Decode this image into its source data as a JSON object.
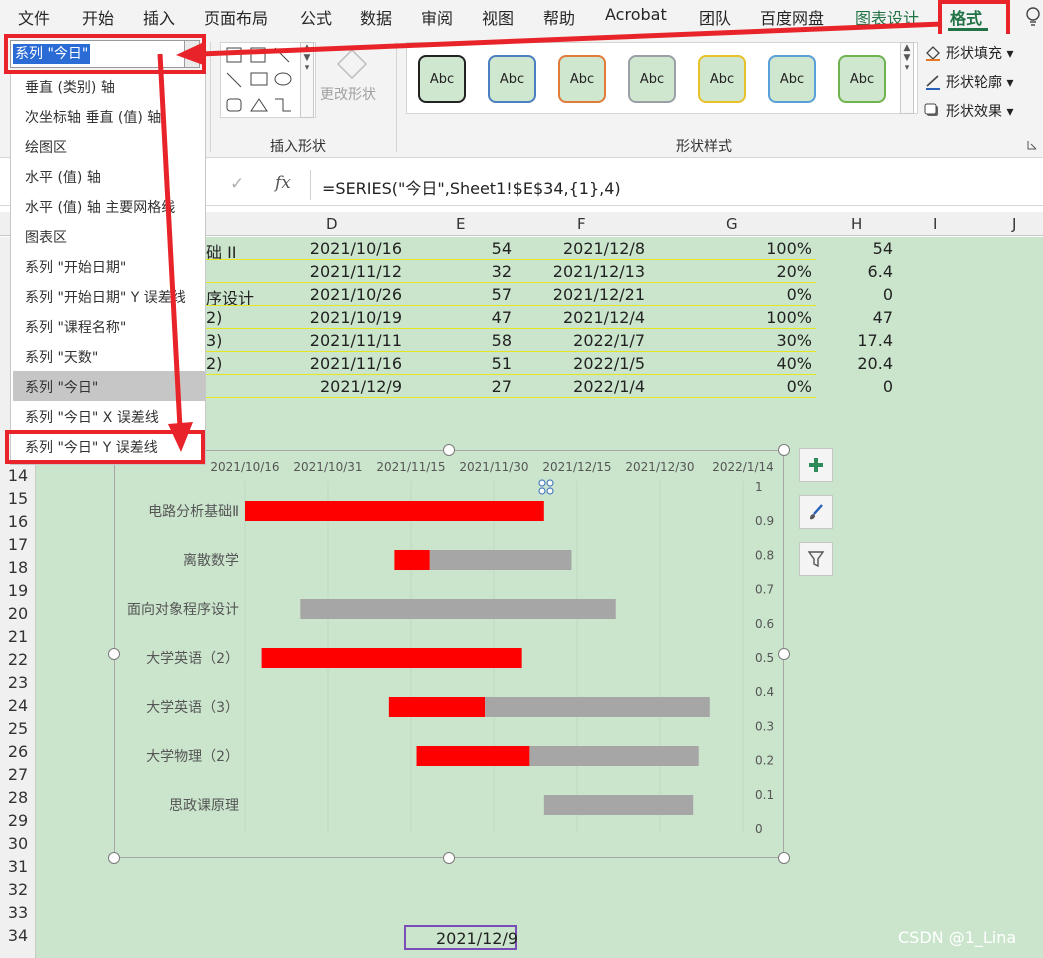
{
  "ribbon": {
    "tabs": [
      "文件",
      "开始",
      "插入",
      "页面布局",
      "公式",
      "数据",
      "审阅",
      "视图",
      "帮助",
      "Acrobat",
      "团队",
      "百度网盘",
      "图表设计",
      "格式"
    ],
    "insert_shapes_label": "插入形状",
    "change_shape_label": "更改形状",
    "shape_styles_label": "形状样式",
    "style_sample": "Abc",
    "shape_fill": "形状填充",
    "shape_outline": "形状轮廓",
    "shape_effects": "形状效果",
    "lightbulb_icon": "lightbulb-icon"
  },
  "namebox": {
    "value": "系列 \"今日\""
  },
  "dropdown": {
    "items": [
      "垂直 (类别) 轴",
      "次坐标轴 垂直 (值) 轴",
      "绘图区",
      "水平 (值) 轴",
      "水平 (值) 轴 主要网格线",
      "图表区",
      "系列 \"开始日期\"",
      "系列 \"开始日期\" Y 误差线",
      "系列 \"课程名称\"",
      "系列 \"天数\"",
      "系列 \"今日\"",
      "系列 \"今日\" X 误差线",
      "系列 \"今日\" Y 误差线"
    ]
  },
  "formula_bar": {
    "cancel": "×",
    "enter": "✓",
    "fx": "fx",
    "formula": "=SERIES(\"今日\",Sheet1!$E$34,{1},4)"
  },
  "columns": [
    "D",
    "E",
    "F",
    "G",
    "H",
    "I",
    "J"
  ],
  "table_rows": [
    {
      "c": "础 II",
      "d": "2021/10/16",
      "e": "54",
      "f": "2021/12/8",
      "g": "100%",
      "h": "54"
    },
    {
      "c": "",
      "d": "2021/11/12",
      "e": "32",
      "f": "2021/12/13",
      "g": "20%",
      "h": "6.4"
    },
    {
      "c": "序设计",
      "d": "2021/10/26",
      "e": "57",
      "f": "2021/12/21",
      "g": "0%",
      "h": "0"
    },
    {
      "c": "2)",
      "d": "2021/10/19",
      "e": "47",
      "f": "2021/12/4",
      "g": "100%",
      "h": "47"
    },
    {
      "c": "3)",
      "d": "2021/11/11",
      "e": "58",
      "f": "2022/1/7",
      "g": "30%",
      "h": "17.4"
    },
    {
      "c": "2)",
      "d": "2021/11/16",
      "e": "51",
      "f": "2022/1/5",
      "g": "40%",
      "h": "20.4"
    },
    {
      "c": "",
      "d": "2021/12/9",
      "e": "27",
      "f": "2022/1/4",
      "g": "0%",
      "h": "0"
    }
  ],
  "row_numbers": [
    "14",
    "15",
    "16",
    "17",
    "18",
    "19",
    "20",
    "21",
    "22",
    "23",
    "24",
    "25",
    "26",
    "27",
    "28",
    "29",
    "30",
    "31",
    "32",
    "33",
    "34"
  ],
  "selected_cell_value": "2021/12/9",
  "watermark": "CSDN @1_Lina",
  "colors": {
    "accent": "#217346",
    "sheet_bg": "#cbe5cd",
    "annotation_red": "#e8242a",
    "done_bar": "#ff0000",
    "remaining_bar": "#a6a6a6"
  },
  "chart_data": {
    "type": "bar",
    "orientation": "horizontal-stacked",
    "categories": [
      "电路分析基础Ⅱ",
      "离散数学",
      "面向对象程序设计",
      "大学英语（2）",
      "大学英语（3）",
      "大学物理（2）",
      "思政课原理"
    ],
    "x_ticks": [
      "2021/10/16",
      "2021/10/31",
      "2021/11/15",
      "2021/11/30",
      "2021/12/15",
      "2021/12/30",
      "2022/1/14"
    ],
    "xlim": [
      "2021/10/16",
      "2022/1/14"
    ],
    "secondary_y_ticks": [
      "1",
      "0.9",
      "0.8",
      "0.7",
      "0.6",
      "0.5",
      "0.4",
      "0.3",
      "0.2",
      "0.1",
      "0"
    ],
    "series": [
      {
        "start": [
          "2021/10/16",
          "2021/11/12",
          "2021/10/26",
          "2021/10/19",
          "2021/11/11",
          "2021/11/16",
          "2021/12/9"
        ]
      },
      {
        "values": [
          54,
          6.4,
          0,
          47,
          17.4,
          20.4,
          0
        ]
      },
      {
        "values": [
          0,
          25.6,
          57,
          0,
          40.6,
          30.6,
          27
        ]
      }
    ],
    "grid": false
  }
}
